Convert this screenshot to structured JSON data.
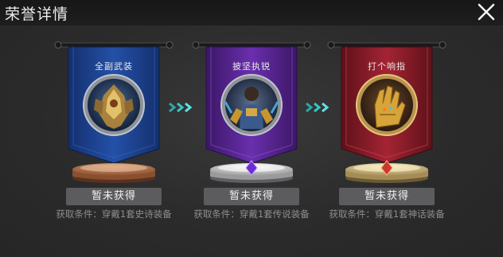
{
  "header": {
    "title": "荣誉详情",
    "close_icon": "close-icon"
  },
  "cards": [
    {
      "label": "全副武装",
      "status": "暂未获得",
      "condition": "获取条件：穿戴1套史诗装备",
      "banner_color": "#1d3f8f",
      "pedestal": "bronze",
      "emblem": "armored-warrior-emblem"
    },
    {
      "label": "披坚执锐",
      "status": "暂未获得",
      "condition": "获取条件：穿戴1套传说装备",
      "banner_color": "#55238e",
      "pedestal": "silver",
      "emblem": "armored-fighter-emblem"
    },
    {
      "label": "打个响指",
      "status": "暂未获得",
      "condition": "获取条件：穿戴1套神话装备",
      "banner_color": "#8c1c28",
      "pedestal": "gold",
      "emblem": "golden-gauntlet-emblem"
    }
  ],
  "separators": [
    "arrow-right-icon",
    "arrow-right-icon"
  ]
}
